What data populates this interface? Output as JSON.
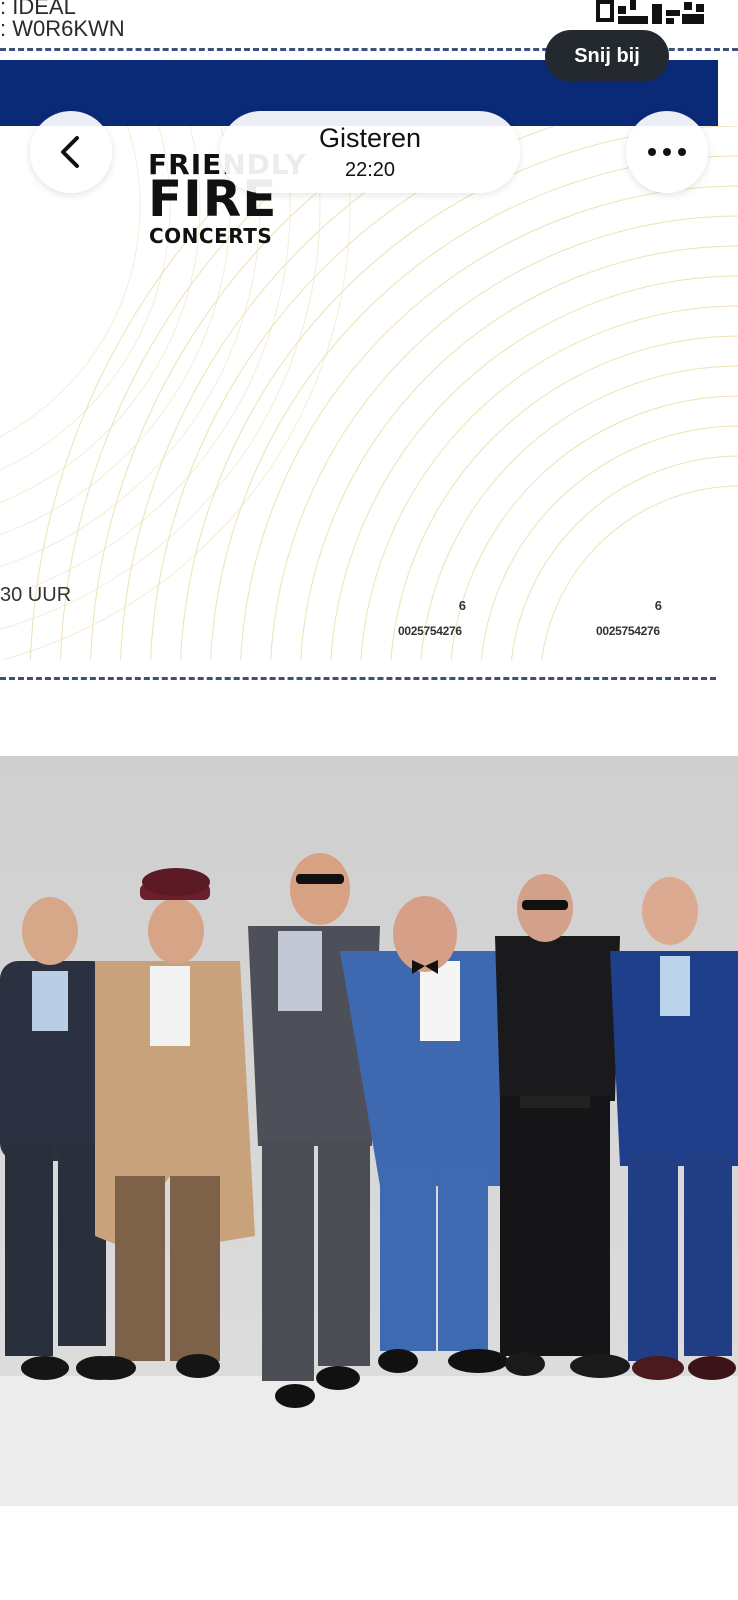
{
  "ticket_top": {
    "line1": ": IDEAL",
    "line2": ": W0R6KWN"
  },
  "header": {
    "title": "Gisteren",
    "subtitle": "22:20",
    "crop_label": "Snij bij"
  },
  "ticket": {
    "logo_line1": "FRIENDLY",
    "logo_line2": "FIRE",
    "logo_line3": "CONCERTS",
    "time_text": "30 UUR",
    "stub_left_num": "6",
    "stub_left_code": "0025754276",
    "stub_right_num": "6",
    "stub_right_code": "0025754276"
  },
  "colors": {
    "ticket_blue": "#0a2a78",
    "dash": "#3d4f7a",
    "crop_bg": "#23292f"
  },
  "icons": [
    "back-chevron-icon",
    "more-dots-icon"
  ]
}
